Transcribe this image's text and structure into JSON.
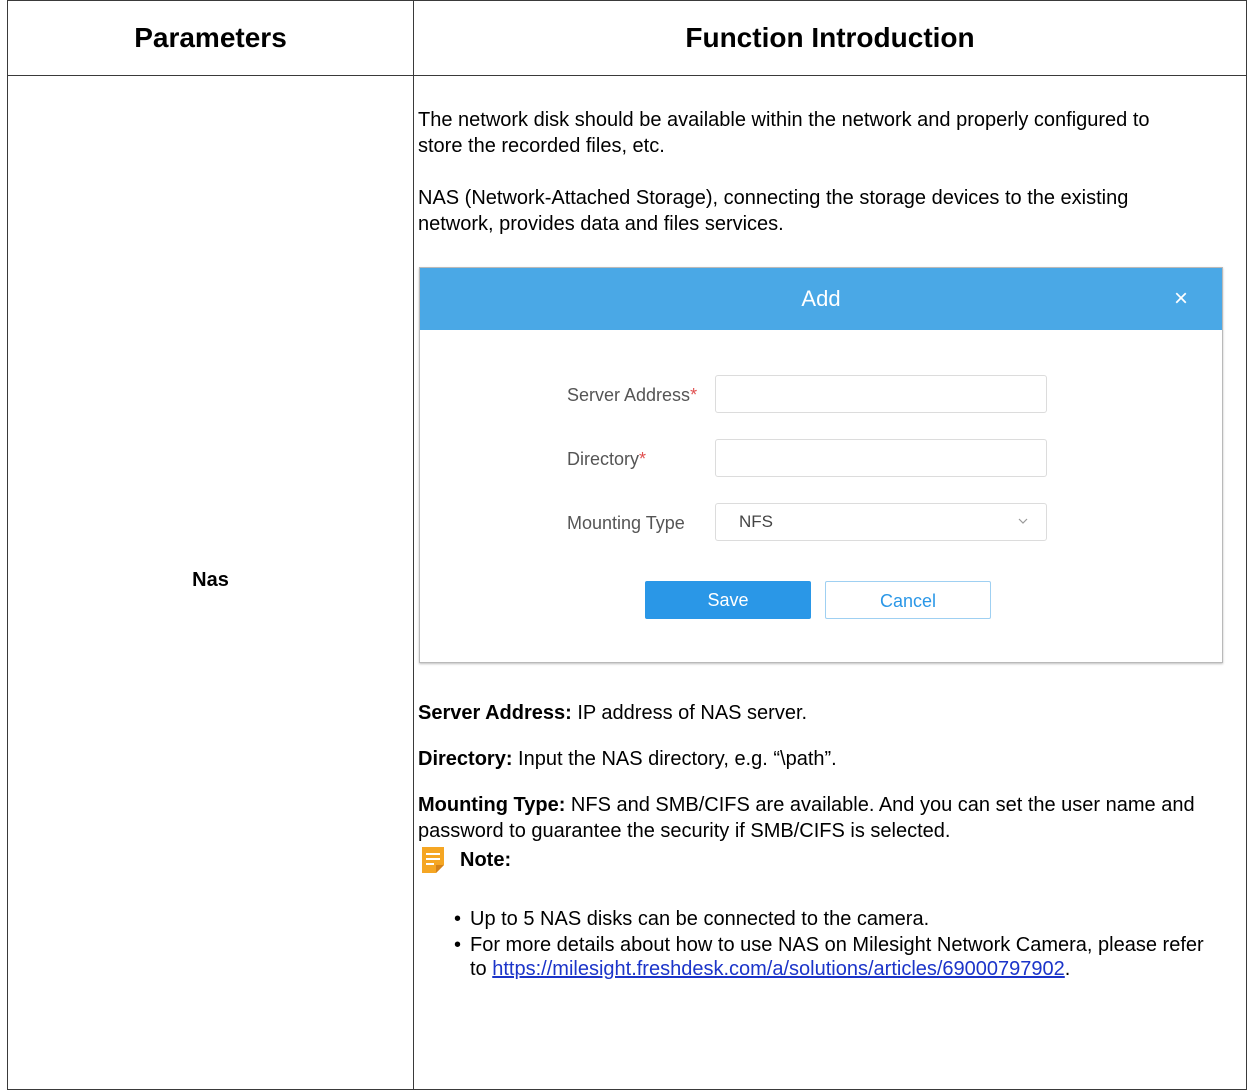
{
  "table": {
    "headers": [
      "Parameters",
      "Function Introduction"
    ],
    "param_name": "Nas"
  },
  "intro": {
    "p1": "The network disk should be available within the network and properly configured to store the recorded files, etc.",
    "p2": "NAS (Network-Attached Storage), connecting the storage devices to the existing network, provides data and files services."
  },
  "dialog": {
    "title": "Add",
    "close_icon": "×",
    "fields": {
      "server_address_label": "Server Address",
      "directory_label": "Directory",
      "mounting_type_label": "Mounting Type",
      "required_mark": "*",
      "server_address_value": "",
      "directory_value": "",
      "mounting_type_value": "NFS"
    },
    "buttons": {
      "save": "Save",
      "cancel": "Cancel"
    },
    "colors": {
      "header": "#4aa8e6",
      "primary": "#2a97e7",
      "required": "#e05050"
    }
  },
  "definitions": [
    {
      "term": "Server Address:",
      "text": " IP address of NAS server."
    },
    {
      "term": "Directory:",
      "text": " Input the NAS directory, e.g. “\\path”."
    },
    {
      "term": "Mounting Type:",
      "text": " NFS and SMB/CIFS are available. And you can set the user name and password to guarantee the security if SMB/CIFS is selected."
    }
  ],
  "note": {
    "label": "Note:",
    "icon": "note-icon",
    "item1": "Up to 5 NAS disks can be connected to the camera.",
    "item2_prefix": "For more details about how to use NAS on Milesight Network Camera, please refer to ",
    "item2_link": "https://milesight.freshdesk.com/a/solutions/articles/69000797902",
    "item2_suffix": "."
  }
}
